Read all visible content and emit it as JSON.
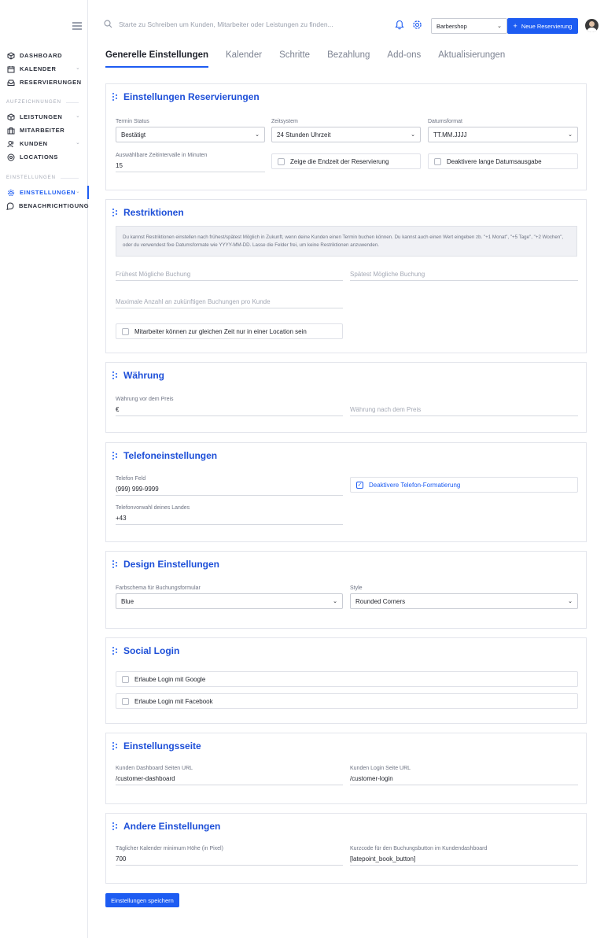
{
  "sidebar": {
    "items": [
      {
        "label": "DASHBOARD",
        "icon": "box-icon"
      },
      {
        "label": "KALENDER",
        "icon": "calendar-icon"
      },
      {
        "label": "RESERVIERUNGEN",
        "icon": "inbox-icon"
      }
    ],
    "section_records": "AUFZEICHNUNGEN",
    "records": [
      {
        "label": "LEISTUNGEN",
        "icon": "box-icon"
      },
      {
        "label": "MITARBEITER",
        "icon": "briefcase-icon"
      },
      {
        "label": "KUNDEN",
        "icon": "users-icon"
      },
      {
        "label": "LOCATIONS",
        "icon": "pin-icon"
      }
    ],
    "section_settings": "EINSTELLUNGEN",
    "settings": [
      {
        "label": "EINSTELLUNGEN",
        "icon": "gear-icon"
      },
      {
        "label": "BENACHRICHTIGUNG",
        "icon": "chat-icon"
      }
    ]
  },
  "topbar": {
    "search_placeholder": "Starte zu Schreiben um Kunden, Mitarbeiter oder Leistungen zu finden...",
    "location_select": "Barbershop",
    "new_button": "Neue Reservierung"
  },
  "tabs": [
    "Generelle Einstellungen",
    "Kalender",
    "Schritte",
    "Bezahlung",
    "Add-ons",
    "Aktualisierungen"
  ],
  "reservations": {
    "title": "Einstellungen Reservierungen",
    "status_label": "Termin Status",
    "status_value": "Bestätigt",
    "time_label": "Zeitsystem",
    "time_value": "24 Stunden Uhrzeit",
    "date_label": "Datumsformat",
    "date_value": "TT.MM.JJJJ",
    "interval_label": "Auswählbare Zeitintervalle in Minuten",
    "interval_value": "15",
    "endtime_check": "Zeige die Endzeit der Reservierung",
    "longdate_check": "Deaktivere lange Datumsausgabe"
  },
  "restrictions": {
    "title": "Restriktionen",
    "info": "Du kannst Restriktionen einstellen nach frühest/spätest Möglich in Zukunft, wenn deine Kunden einen Termin buchen können. Du kannst auch einen Wert eingeben zb. \"+1 Monat\", \"+5 Tage\", \"+2 Wochen\", oder du verwendest fixe Datumsformate wie YYYY-MM-DD. Lasse die Felder frei, um keine Restriktionen anzuwenden.",
    "earliest_placeholder": "Frühest Mögliche Buchung",
    "latest_placeholder": "Spätest Mögliche Buchung",
    "max_placeholder": "Maximale Anzahl an zukünftigen Buchungen pro Kunde",
    "location_check": "Mitarbeiter können zur gleichen Zeit nur in einer Location sein"
  },
  "currency": {
    "title": "Währung",
    "before_label": "Währung vor dem Preis",
    "before_value": "€",
    "after_placeholder": "Währung nach dem Preis"
  },
  "phone": {
    "title": "Telefoneinstellungen",
    "field_label": "Telefon Feld",
    "field_value": "(999) 999-9999",
    "format_check": "Deaktivere Telefon-Formatierung",
    "prefix_label": "Telefonvorwahl deines Landes",
    "prefix_value": "+43"
  },
  "design": {
    "title": "Design Einstellungen",
    "color_label": "Farbschema für Buchungsformular",
    "color_value": "Blue",
    "style_label": "Style",
    "style_value": "Rounded Corners"
  },
  "social": {
    "title": "Social Login",
    "google": "Erlaube Login mit Google",
    "facebook": "Erlaube Login mit Facebook"
  },
  "pages": {
    "title": "Einstellungsseite",
    "dashboard_label": "Kunden Dashboard Seiten URL",
    "dashboard_value": "/customer-dashboard",
    "login_label": "Kunden Login Seite URL",
    "login_value": "/customer-login"
  },
  "other": {
    "title": "Andere Einstellungen",
    "height_label": "Täglicher Kalender minimum Höhe (in Pixel)",
    "height_value": "700",
    "shortcode_label": "Kurzcode für den Buchungsbutton im Kundendashboard",
    "shortcode_value": "[latepoint_book_button]"
  },
  "save_button": "Einstellungen speichern",
  "colors": {
    "accent": "#1d5cf2",
    "title": "#1d4fd8",
    "border": "#e3e5ec"
  }
}
